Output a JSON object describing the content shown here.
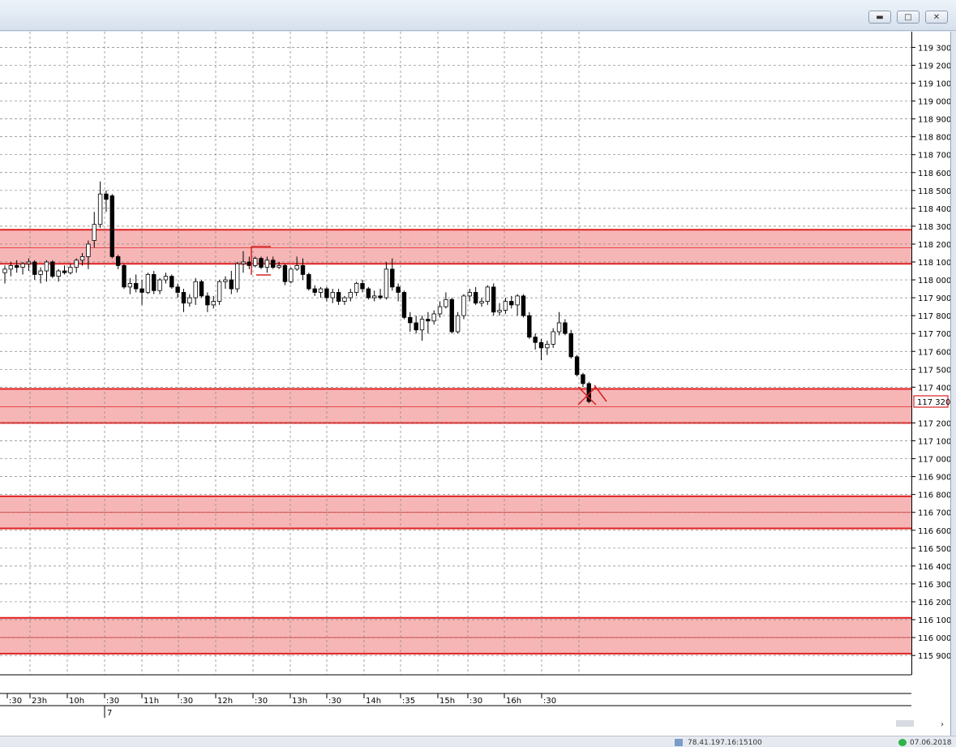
{
  "window": {
    "minimize_icon": "minimize-icon",
    "maximize_icon": "maximize-icon",
    "close_icon": "close-icon"
  },
  "status": {
    "connection_icon": "network-icon",
    "connection_text": "78.41.197.16:15100",
    "online_icon": "online-status-icon",
    "date_text": "07.06.2018"
  },
  "colors": {
    "zone_fill": "#f7b6b6",
    "zone_border": "#e02020",
    "bull_candle": "#ffffff",
    "bear_candle": "#000000",
    "grid": "#808080",
    "price_marker": "#d42020"
  },
  "chart_data": {
    "type": "candlestick",
    "ylim": [
      115880,
      119380
    ],
    "y_ticks": [
      119300,
      119200,
      119100,
      119000,
      118900,
      118800,
      118700,
      118600,
      118500,
      118400,
      118300,
      118200,
      118100,
      118000,
      117900,
      117800,
      117700,
      117600,
      117500,
      117400,
      117200,
      117100,
      117000,
      116900,
      116800,
      116700,
      116600,
      116500,
      116400,
      116300,
      116200,
      116100,
      116000,
      115900
    ],
    "y_tick_labels": [
      "119 300",
      "119 200",
      "119 100",
      "119 000",
      "118 900",
      "118 800",
      "118 700",
      "118 600",
      "118 500",
      "118 400",
      "118 300",
      "118 200",
      "118 100",
      "118 000",
      "117 900",
      "117 800",
      "117 700",
      "117 600",
      "117 500",
      "117 400",
      "117 200",
      "117 100",
      "117 000",
      "116 900",
      "116 800",
      "116 700",
      "116 600",
      "116 500",
      "116 400",
      "116 300",
      "116 200",
      "116 100",
      "116 000",
      "115 900"
    ],
    "current_price": 117320,
    "current_price_label": "117 320",
    "x_labels": [
      ":30",
      "23h",
      "10h",
      ":30",
      "11h",
      ":30",
      "12h",
      ":30",
      "13h",
      ":30",
      "14h",
      ":35",
      "15h",
      ":30",
      "16h",
      ":30"
    ],
    "date_marker": "7",
    "zones": [
      {
        "top": 118280,
        "mid": 118180,
        "bottom": 118090
      },
      {
        "top": 117390,
        "mid": 117290,
        "bottom": 117200
      },
      {
        "top": 116790,
        "mid": 116700,
        "bottom": 116610
      },
      {
        "top": 116110,
        "mid": 116000,
        "bottom": 115910
      }
    ],
    "candles": [
      {
        "o": 118040,
        "h": 118080,
        "l": 117980,
        "c": 118060
      },
      {
        "o": 118060,
        "h": 118100,
        "l": 118020,
        "c": 118080
      },
      {
        "o": 118080,
        "h": 118110,
        "l": 118040,
        "c": 118070
      },
      {
        "o": 118070,
        "h": 118100,
        "l": 118030,
        "c": 118090
      },
      {
        "o": 118090,
        "h": 118120,
        "l": 118050,
        "c": 118100
      },
      {
        "o": 118100,
        "h": 118110,
        "l": 118000,
        "c": 118030
      },
      {
        "o": 118030,
        "h": 118070,
        "l": 117980,
        "c": 118050
      },
      {
        "o": 118050,
        "h": 118110,
        "l": 117990,
        "c": 118100
      },
      {
        "o": 118100,
        "h": 118110,
        "l": 118010,
        "c": 118020
      },
      {
        "o": 118020,
        "h": 118060,
        "l": 117990,
        "c": 118050
      },
      {
        "o": 118050,
        "h": 118080,
        "l": 118030,
        "c": 118040
      },
      {
        "o": 118040,
        "h": 118090,
        "l": 118030,
        "c": 118070
      },
      {
        "o": 118070,
        "h": 118120,
        "l": 118040,
        "c": 118110
      },
      {
        "o": 118110,
        "h": 118150,
        "l": 118080,
        "c": 118130
      },
      {
        "o": 118130,
        "h": 118220,
        "l": 118060,
        "c": 118200
      },
      {
        "o": 118220,
        "h": 118380,
        "l": 118180,
        "c": 118310
      },
      {
        "o": 118310,
        "h": 118550,
        "l": 118290,
        "c": 118480
      },
      {
        "o": 118480,
        "h": 118500,
        "l": 118380,
        "c": 118450
      },
      {
        "o": 118470,
        "h": 118480,
        "l": 118120,
        "c": 118130
      },
      {
        "o": 118130,
        "h": 118140,
        "l": 118060,
        "c": 118080
      },
      {
        "o": 118080,
        "h": 118090,
        "l": 117950,
        "c": 117960
      },
      {
        "o": 117960,
        "h": 118010,
        "l": 117920,
        "c": 117980
      },
      {
        "o": 117980,
        "h": 118030,
        "l": 117930,
        "c": 117950
      },
      {
        "o": 117950,
        "h": 118000,
        "l": 117860,
        "c": 117930
      },
      {
        "o": 117930,
        "h": 118040,
        "l": 117920,
        "c": 118030
      },
      {
        "o": 118030,
        "h": 118050,
        "l": 117920,
        "c": 117940
      },
      {
        "o": 117940,
        "h": 118010,
        "l": 117920,
        "c": 118000
      },
      {
        "o": 118000,
        "h": 118040,
        "l": 117980,
        "c": 118020
      },
      {
        "o": 118020,
        "h": 118030,
        "l": 117950,
        "c": 117960
      },
      {
        "o": 117960,
        "h": 117980,
        "l": 117900,
        "c": 117930
      },
      {
        "o": 117930,
        "h": 117950,
        "l": 117820,
        "c": 117870
      },
      {
        "o": 117870,
        "h": 117920,
        "l": 117850,
        "c": 117900
      },
      {
        "o": 117900,
        "h": 118010,
        "l": 117860,
        "c": 117990
      },
      {
        "o": 117990,
        "h": 118000,
        "l": 117900,
        "c": 117910
      },
      {
        "o": 117910,
        "h": 117930,
        "l": 117820,
        "c": 117860
      },
      {
        "o": 117860,
        "h": 117910,
        "l": 117840,
        "c": 117880
      },
      {
        "o": 117880,
        "h": 118000,
        "l": 117860,
        "c": 117990
      },
      {
        "o": 117990,
        "h": 118020,
        "l": 117950,
        "c": 118000
      },
      {
        "o": 118000,
        "h": 118050,
        "l": 117920,
        "c": 117950
      },
      {
        "o": 117950,
        "h": 118100,
        "l": 117930,
        "c": 118090
      },
      {
        "o": 118090,
        "h": 118160,
        "l": 118040,
        "c": 118100
      },
      {
        "o": 118100,
        "h": 118130,
        "l": 118060,
        "c": 118080
      },
      {
        "o": 118080,
        "h": 118130,
        "l": 118070,
        "c": 118120
      },
      {
        "o": 118120,
        "h": 118130,
        "l": 118060,
        "c": 118070
      },
      {
        "o": 118070,
        "h": 118130,
        "l": 118040,
        "c": 118110
      },
      {
        "o": 118110,
        "h": 118130,
        "l": 118060,
        "c": 118070
      },
      {
        "o": 118070,
        "h": 118100,
        "l": 118060,
        "c": 118080
      },
      {
        "o": 118080,
        "h": 118090,
        "l": 117970,
        "c": 117990
      },
      {
        "o": 117990,
        "h": 118070,
        "l": 117980,
        "c": 118060
      },
      {
        "o": 118060,
        "h": 118130,
        "l": 118050,
        "c": 118080
      },
      {
        "o": 118080,
        "h": 118120,
        "l": 118000,
        "c": 118030
      },
      {
        "o": 118030,
        "h": 118040,
        "l": 117940,
        "c": 117950
      },
      {
        "o": 117950,
        "h": 117970,
        "l": 117910,
        "c": 117930
      },
      {
        "o": 117930,
        "h": 117960,
        "l": 117900,
        "c": 117950
      },
      {
        "o": 117950,
        "h": 117960,
        "l": 117880,
        "c": 117900
      },
      {
        "o": 117900,
        "h": 117950,
        "l": 117870,
        "c": 117930
      },
      {
        "o": 117930,
        "h": 117950,
        "l": 117860,
        "c": 117880
      },
      {
        "o": 117880,
        "h": 117910,
        "l": 117860,
        "c": 117900
      },
      {
        "o": 117900,
        "h": 117950,
        "l": 117880,
        "c": 117930
      },
      {
        "o": 117930,
        "h": 117990,
        "l": 117910,
        "c": 117980
      },
      {
        "o": 117980,
        "h": 118000,
        "l": 117930,
        "c": 117950
      },
      {
        "o": 117950,
        "h": 117960,
        "l": 117890,
        "c": 117900
      },
      {
        "o": 117900,
        "h": 117940,
        "l": 117880,
        "c": 117910
      },
      {
        "o": 117910,
        "h": 117950,
        "l": 117890,
        "c": 117900
      },
      {
        "o": 117900,
        "h": 118100,
        "l": 117890,
        "c": 118060
      },
      {
        "o": 118060,
        "h": 118120,
        "l": 117940,
        "c": 117960
      },
      {
        "o": 117960,
        "h": 117980,
        "l": 117880,
        "c": 117930
      },
      {
        "o": 117930,
        "h": 117940,
        "l": 117780,
        "c": 117790
      },
      {
        "o": 117790,
        "h": 117820,
        "l": 117710,
        "c": 117760
      },
      {
        "o": 117760,
        "h": 117800,
        "l": 117700,
        "c": 117720
      },
      {
        "o": 117720,
        "h": 117800,
        "l": 117660,
        "c": 117780
      },
      {
        "o": 117780,
        "h": 117820,
        "l": 117700,
        "c": 117770
      },
      {
        "o": 117770,
        "h": 117830,
        "l": 117750,
        "c": 117810
      },
      {
        "o": 117810,
        "h": 117880,
        "l": 117790,
        "c": 117850
      },
      {
        "o": 117850,
        "h": 117930,
        "l": 117840,
        "c": 117890
      },
      {
        "o": 117890,
        "h": 117900,
        "l": 117700,
        "c": 117710
      },
      {
        "o": 117710,
        "h": 117820,
        "l": 117700,
        "c": 117800
      },
      {
        "o": 117800,
        "h": 117920,
        "l": 117780,
        "c": 117910
      },
      {
        "o": 117910,
        "h": 117950,
        "l": 117880,
        "c": 117930
      },
      {
        "o": 117930,
        "h": 117960,
        "l": 117860,
        "c": 117870
      },
      {
        "o": 117870,
        "h": 117900,
        "l": 117850,
        "c": 117880
      },
      {
        "o": 117880,
        "h": 117970,
        "l": 117860,
        "c": 117960
      },
      {
        "o": 117960,
        "h": 117980,
        "l": 117800,
        "c": 117820
      },
      {
        "o": 117820,
        "h": 117870,
        "l": 117800,
        "c": 117830
      },
      {
        "o": 117830,
        "h": 117900,
        "l": 117810,
        "c": 117880
      },
      {
        "o": 117880,
        "h": 117910,
        "l": 117840,
        "c": 117860
      },
      {
        "o": 117860,
        "h": 117920,
        "l": 117800,
        "c": 117910
      },
      {
        "o": 117910,
        "h": 117920,
        "l": 117790,
        "c": 117800
      },
      {
        "o": 117800,
        "h": 117820,
        "l": 117670,
        "c": 117680
      },
      {
        "o": 117680,
        "h": 117700,
        "l": 117610,
        "c": 117650
      },
      {
        "o": 117650,
        "h": 117670,
        "l": 117550,
        "c": 117620
      },
      {
        "o": 117620,
        "h": 117660,
        "l": 117580,
        "c": 117640
      },
      {
        "o": 117640,
        "h": 117730,
        "l": 117620,
        "c": 117710
      },
      {
        "o": 117710,
        "h": 117820,
        "l": 117690,
        "c": 117760
      },
      {
        "o": 117760,
        "h": 117780,
        "l": 117690,
        "c": 117700
      },
      {
        "o": 117700,
        "h": 117720,
        "l": 117560,
        "c": 117570
      },
      {
        "o": 117570,
        "h": 117580,
        "l": 117460,
        "c": 117470
      },
      {
        "o": 117470,
        "h": 117480,
        "l": 117400,
        "c": 117420
      },
      {
        "o": 117420,
        "h": 117430,
        "l": 117310,
        "c": 117320
      }
    ]
  }
}
